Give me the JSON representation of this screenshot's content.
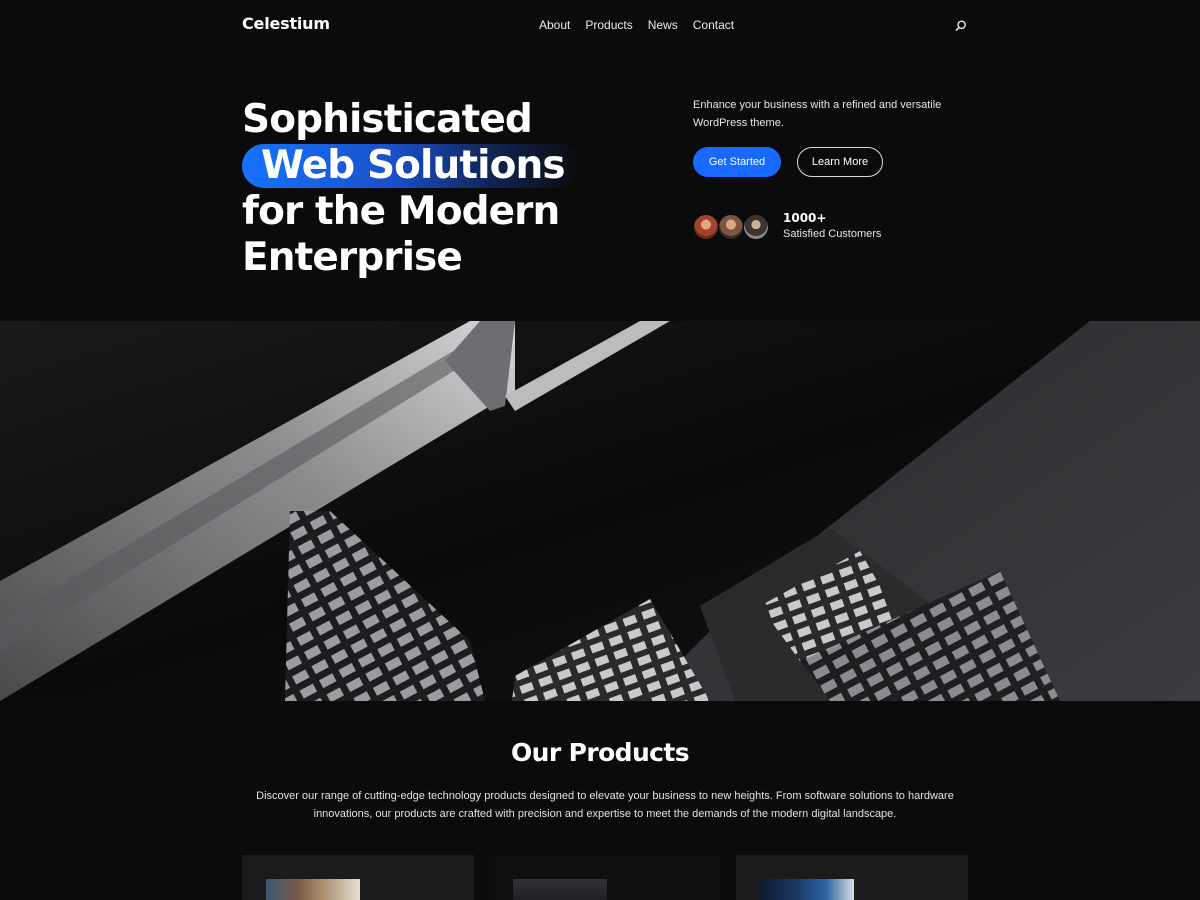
{
  "header": {
    "logo": "Celestium",
    "nav": [
      "About",
      "Products",
      "News",
      "Contact"
    ],
    "search_icon": "search-icon"
  },
  "hero": {
    "title_line1": "Sophisticated",
    "title_highlight": "Web Solutions",
    "title_line3": "for the Modern",
    "title_line4": "Enterprise",
    "description": "Enhance your business with a refined and versatile WordPress theme.",
    "primary_button": "Get Started",
    "secondary_button": "Learn More",
    "stat_number": "1000+",
    "stat_label": "Satisfied Customers"
  },
  "products": {
    "title": "Our Products",
    "description": "Discover our range of cutting-edge technology products designed to elevate your business to new heights. From software solutions to hardware innovations, our products are crafted with precision and expertise to meet the demands of the modern digital landscape."
  },
  "colors": {
    "background": "#0b0b0c",
    "accent": "#1769ff",
    "card": "#1b1b1e"
  }
}
